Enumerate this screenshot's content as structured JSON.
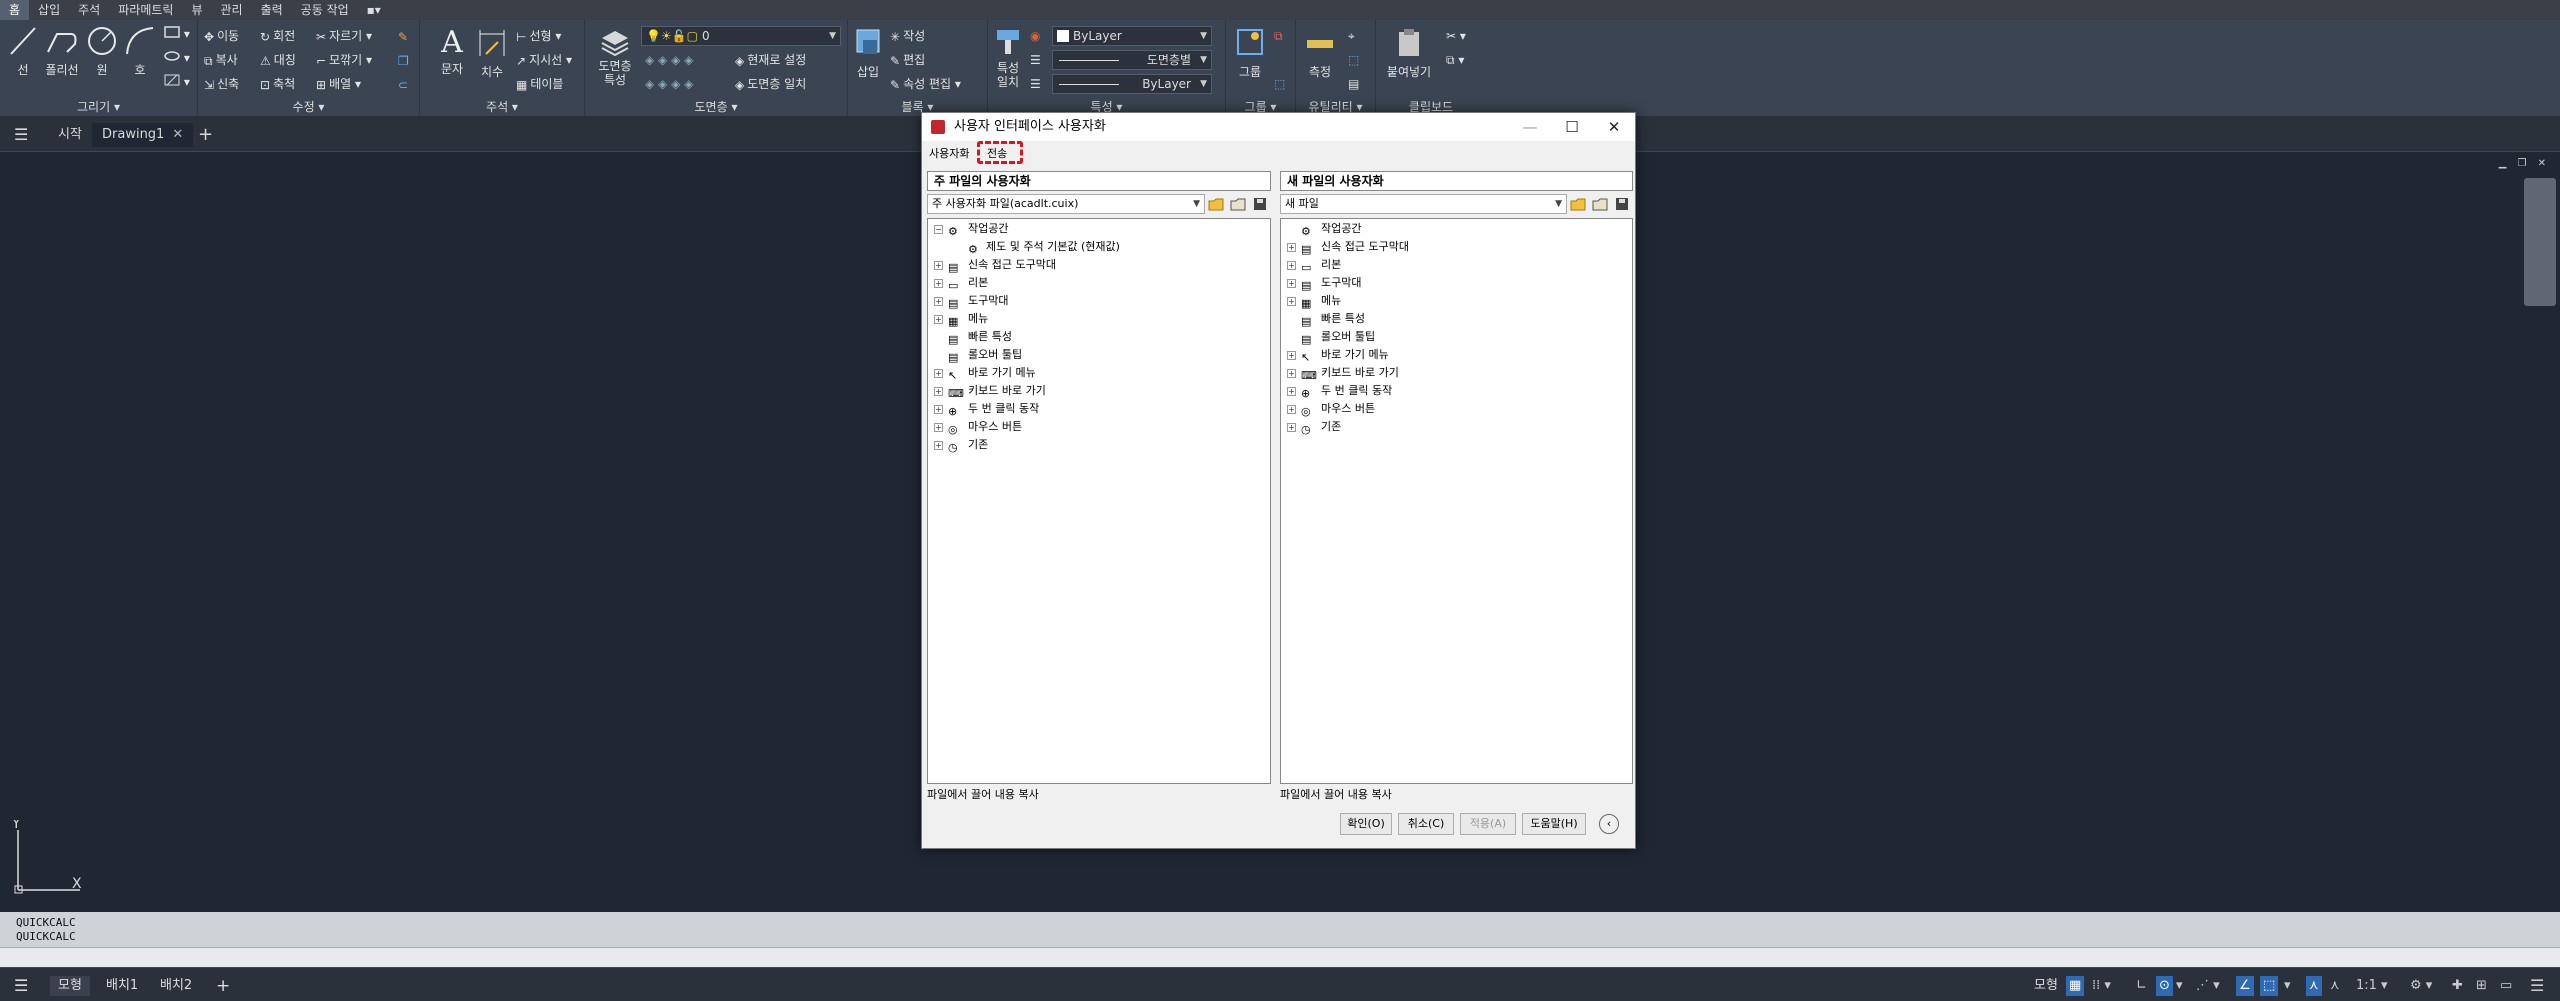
{
  "menubar": {
    "tabs": [
      "홈",
      "삽입",
      "주석",
      "파라메트릭",
      "뷰",
      "관리",
      "출력",
      "공동 작업",
      "▪▾"
    ],
    "active": 0
  },
  "ribbon": {
    "draw": {
      "title": "그리기 ▾",
      "line": "선",
      "polyline": "폴리선",
      "circle": "원",
      "arc": "호"
    },
    "modify": {
      "title": "수정 ▾",
      "move": "이동",
      "rotate": "회전",
      "trim": "자르기 ▾",
      "copy": "복사",
      "mirror": "대칭",
      "fillet": "모깎기 ▾",
      "stretch": "신축",
      "scale": "축척",
      "array": "배열 ▾"
    },
    "annotation": {
      "title": "주석 ▾",
      "text": "문자",
      "dimension": "치수",
      "linear": "선형 ▾",
      "leader": "지시선 ▾",
      "table": "테이블"
    },
    "layers": {
      "title": "도면층 ▾",
      "props": "도면층 특성",
      "layer_value": "0",
      "make_current": "현재로 설정",
      "match": "도면층 일치"
    },
    "block": {
      "title": "블록 ▾",
      "insert": "삽입",
      "create": "작성",
      "edit": "편집",
      "attr_edit": "속성 편집 ▾"
    },
    "properties": {
      "title": "특성 ▾",
      "match": "특성 일치",
      "color": "ByLayer",
      "linetype": "도면층별",
      "lineweight": "ByLayer"
    },
    "groups": {
      "title": "그룹 ▾",
      "group": "그룹"
    },
    "utilities": {
      "title": "유틸리티 ▾",
      "measure": "측정"
    },
    "clipboard": {
      "title": "클립보드",
      "paste": "붙여넣기"
    }
  },
  "filetabs": {
    "start": "시작",
    "drawing": "Drawing1"
  },
  "cmd_history": [
    "QUICKCALC",
    "QUICKCALC"
  ],
  "statusbar": {
    "tabs": [
      "모형",
      "배치1",
      "배치2"
    ],
    "model": "모형",
    "scale": "1:1 ▾"
  },
  "dialog": {
    "title": "사용자 인터페이스 사용자화",
    "menu": [
      "사용자화",
      "전송"
    ],
    "left": {
      "header": "주 파일의 사용자화",
      "combo": "주 사용자화 파일(acadlt.cuix)",
      "footer": "파일에서 끌어 내용 복사",
      "tree": [
        "작업공간",
        "제도 및 주석 기본값 (현재값)",
        "신속 접근 도구막대",
        "리본",
        "도구막대",
        "메뉴",
        "빠른 특성",
        "롤오버 툴팁",
        "바로 가기 메뉴",
        "키보드 바로 가기",
        "두 번 클릭 동작",
        "마우스 버튼",
        "기존"
      ]
    },
    "right": {
      "header": "새 파일의 사용자화",
      "combo": "새 파일",
      "footer": "파일에서 끌어 내용 복사",
      "tree": [
        "작업공간",
        "신속 접근 도구막대",
        "리본",
        "도구막대",
        "메뉴",
        "빠른 특성",
        "롤오버 툴팁",
        "바로 가기 메뉴",
        "키보드 바로 가기",
        "두 번 클릭 동작",
        "마우스 버튼",
        "기존"
      ]
    },
    "buttons": {
      "ok": "확인(O)",
      "cancel": "취소(C)",
      "apply": "적용(A)",
      "help": "도움말(H)"
    }
  }
}
